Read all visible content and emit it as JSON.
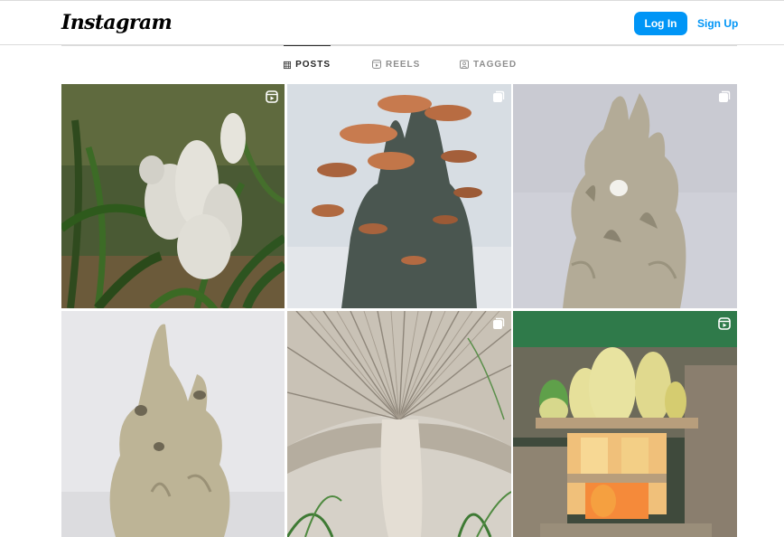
{
  "header": {
    "logo_text": "Instagram",
    "login_label": "Log In",
    "signup_label": "Sign Up"
  },
  "tabs": [
    {
      "label": "POSTS",
      "icon": "grid-icon",
      "active": true
    },
    {
      "label": "REELS",
      "icon": "reels-icon",
      "active": false
    },
    {
      "label": "TAGGED",
      "icon": "tagged-icon",
      "active": false
    }
  ],
  "posts": [
    {
      "subject": "white clay vessel sculpture among garden plants",
      "badge": "reel-icon"
    },
    {
      "subject": "grey clay mushroom tower with terracotta caps",
      "badge": "carousel-icon"
    },
    {
      "subject": "beige clay flame-like sculpture with openings",
      "badge": "carousel-icon"
    },
    {
      "subject": "beige clay multi-spout vessel sculpture",
      "badge": "none"
    },
    {
      "subject": "underside of a mushroom cap with gills and stem",
      "badge": "carousel-icon"
    },
    {
      "subject": "glazed yellow and green vases on kiln shelf",
      "badge": "reel-icon"
    }
  ],
  "colors": {
    "accent": "#0095f6",
    "border": "#dbdbdb",
    "text_active": "#262626",
    "text_muted": "#8e8e8e"
  }
}
